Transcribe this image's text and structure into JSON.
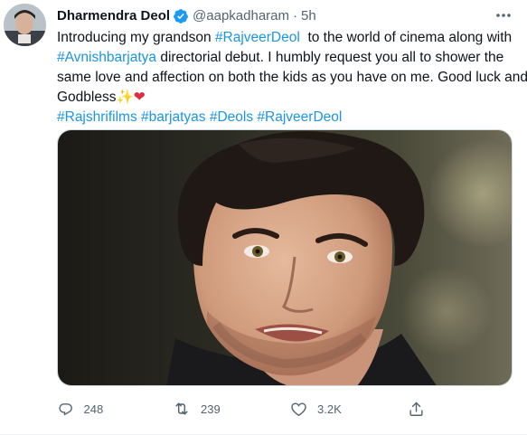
{
  "author": {
    "name": "Dharmendra Deol",
    "handle": "@aapkadharam",
    "separator": "·",
    "time": "5h",
    "verified_color": "#1d9bf0"
  },
  "tweet": {
    "lines": [
      [
        "Introducing my grandson ",
        "#RajveerDeol",
        "  to the world of cinema along with"
      ],
      [
        "#Avnishbarjatya",
        " directorial debut. I humbly request you all to shower the"
      ],
      [
        "same love and affection on both the kids as you have on me. Good luck and"
      ],
      [
        "Godbless",
        "✨",
        "❤"
      ],
      [
        "#Rajshrifilms",
        " ",
        "#barjatyas",
        " ",
        "#Deols",
        " ",
        "#RajveerDeol"
      ]
    ],
    "hashtag_color": "#1b95e0"
  },
  "actions": {
    "replies": "248",
    "retweets": "239",
    "likes": "3.2K"
  },
  "icons": {
    "more": "more-horizontal-icon",
    "reply": "reply-icon",
    "retweet": "retweet-icon",
    "like": "heart-icon",
    "share": "share-icon",
    "verified": "verified-badge-icon"
  }
}
